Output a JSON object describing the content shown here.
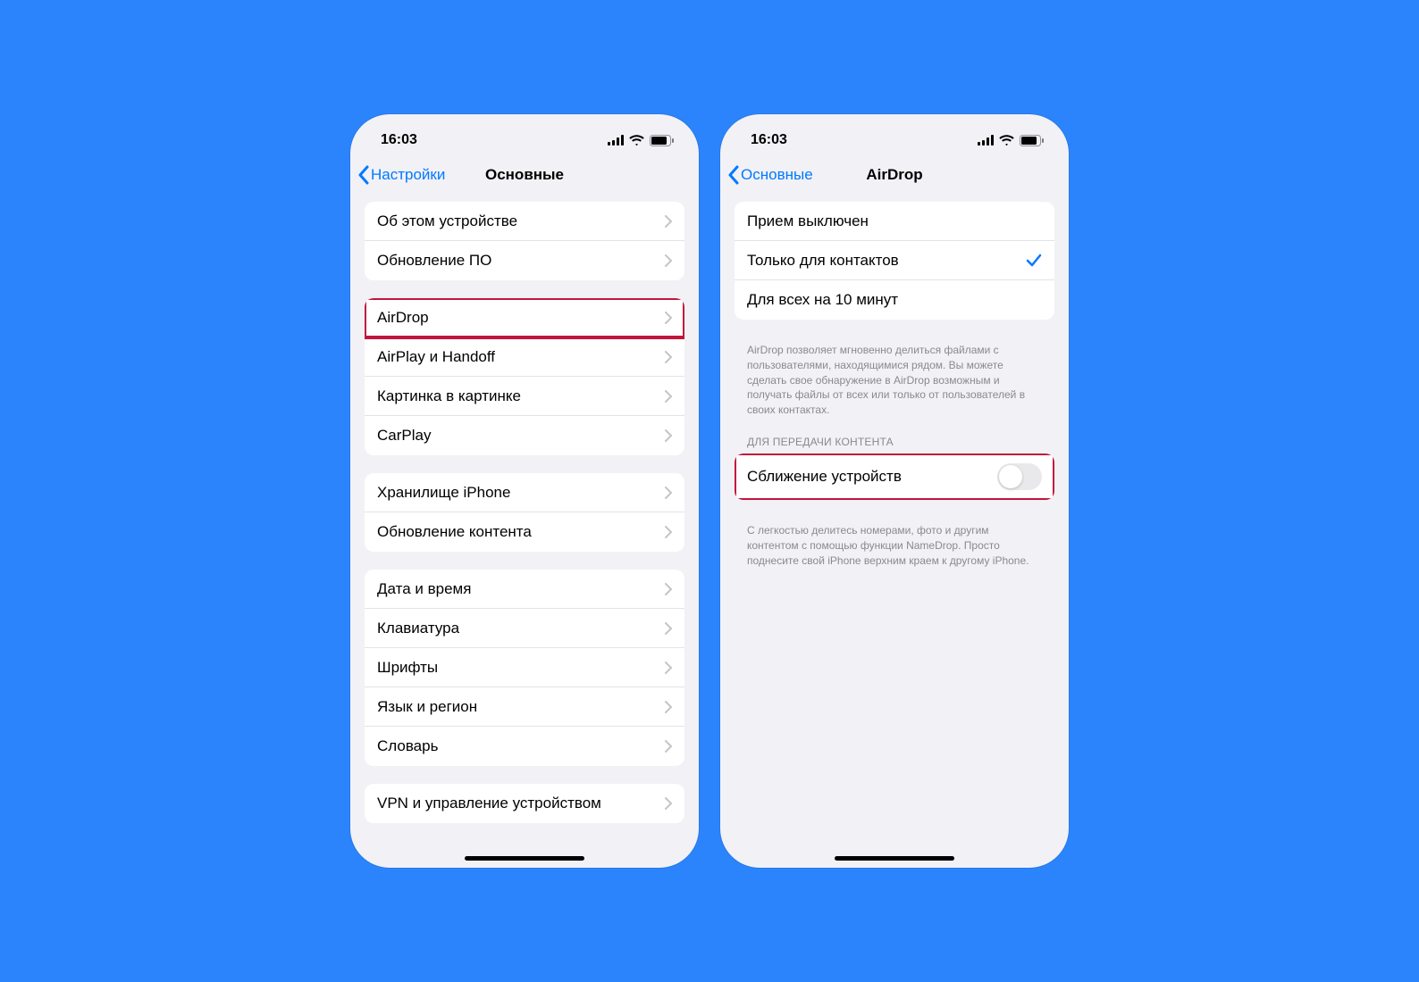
{
  "statusBar": {
    "time": "16:03"
  },
  "left": {
    "back": "Настройки",
    "title": "Основные",
    "groups": [
      {
        "rows": [
          {
            "label": "Об этом устройстве",
            "type": "chevron"
          },
          {
            "label": "Обновление ПО",
            "type": "chevron"
          }
        ]
      },
      {
        "rows": [
          {
            "label": "AirDrop",
            "type": "chevron",
            "highlight": true
          },
          {
            "label": "AirPlay и Handoff",
            "type": "chevron"
          },
          {
            "label": "Картинка в картинке",
            "type": "chevron"
          },
          {
            "label": "CarPlay",
            "type": "chevron"
          }
        ]
      },
      {
        "rows": [
          {
            "label": "Хранилище iPhone",
            "type": "chevron"
          },
          {
            "label": "Обновление контента",
            "type": "chevron"
          }
        ]
      },
      {
        "rows": [
          {
            "label": "Дата и время",
            "type": "chevron"
          },
          {
            "label": "Клавиатура",
            "type": "chevron"
          },
          {
            "label": "Шрифты",
            "type": "chevron"
          },
          {
            "label": "Язык и регион",
            "type": "chevron"
          },
          {
            "label": "Словарь",
            "type": "chevron"
          }
        ]
      },
      {
        "rows": [
          {
            "label": "VPN и управление устройством",
            "type": "chevron"
          }
        ]
      }
    ]
  },
  "right": {
    "back": "Основные",
    "title": "AirDrop",
    "groups": [
      {
        "rows": [
          {
            "label": "Прием выключен",
            "type": "plain"
          },
          {
            "label": "Только для контактов",
            "type": "check"
          },
          {
            "label": "Для всех на 10 минут",
            "type": "plain"
          }
        ],
        "footer": "AirDrop позволяет мгновенно делиться файлами с пользователями, находящимися рядом. Вы можете сделать свое обнаружение в AirDrop возможным и получать файлы от всех или только от пользователей в своих контактах."
      },
      {
        "header": "ДЛЯ ПЕРЕДАЧИ КОНТЕНТА",
        "rows": [
          {
            "label": "Сближение устройств",
            "type": "toggle",
            "on": false,
            "highlight": true
          }
        ],
        "footer": "С легкостью делитесь номерами, фото и другим контентом с помощью функции NameDrop. Просто поднесите свой iPhone верхним краем к другому iPhone."
      }
    ]
  }
}
